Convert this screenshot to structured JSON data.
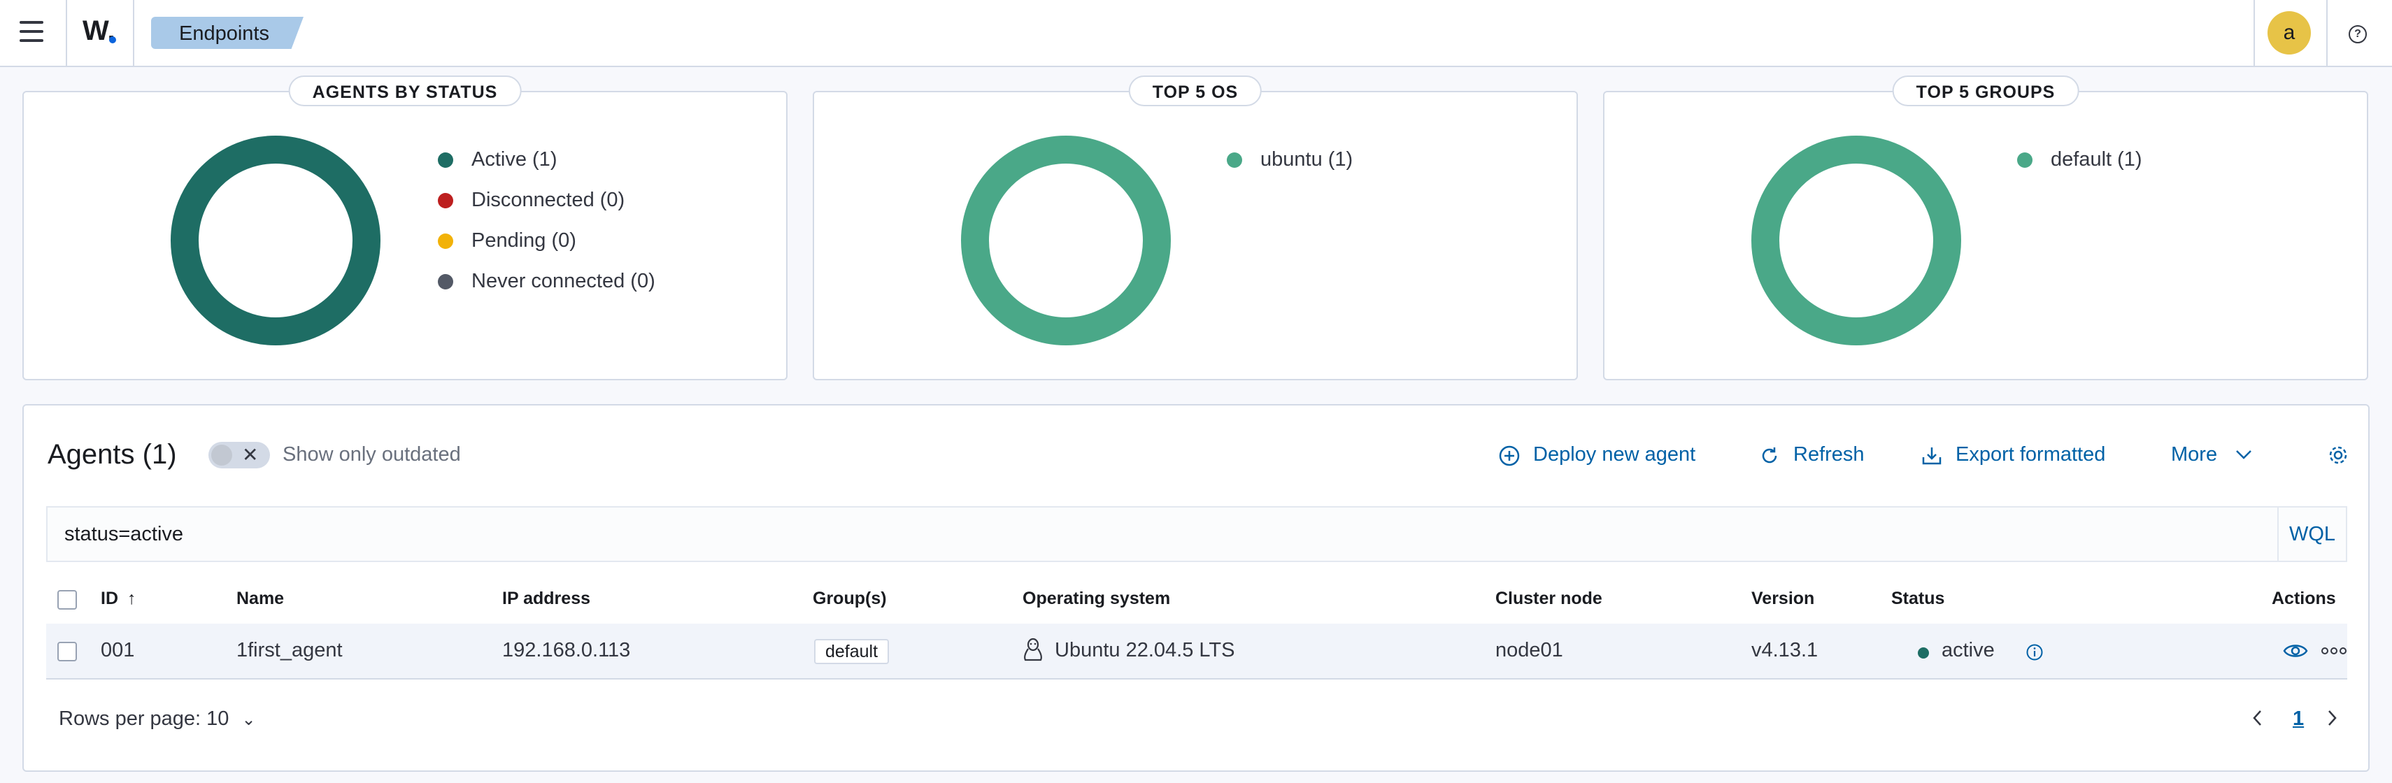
{
  "header": {
    "logo": "W.",
    "breadcrumb": "Endpoints",
    "avatar_initial": "a",
    "help_glyph": "?"
  },
  "panels": [
    {
      "title": "AGENTS BY STATUS",
      "ring_color": "#1e6d64",
      "legend": [
        {
          "label": "Active (1)",
          "color": "#1e6d64"
        },
        {
          "label": "Disconnected (0)",
          "color": "#bd1f1f"
        },
        {
          "label": "Pending (0)",
          "color": "#f2b208"
        },
        {
          "label": "Never connected (0)",
          "color": "#535966"
        }
      ]
    },
    {
      "title": "TOP 5 OS",
      "ring_color": "#4aa888",
      "legend": [
        {
          "label": "ubuntu (1)",
          "color": "#4aa888"
        }
      ]
    },
    {
      "title": "TOP 5 GROUPS",
      "ring_color": "#4aa888",
      "legend": [
        {
          "label": "default (1)",
          "color": "#4aa888"
        }
      ]
    }
  ],
  "agents": {
    "title": "Agents (1)",
    "toggle_label": "Show only outdated",
    "toggle_on": false,
    "actions": {
      "deploy": "Deploy new agent",
      "refresh": "Refresh",
      "export": "Export formatted",
      "more": "More"
    },
    "search_value": "status=active",
    "search_mode": "WQL",
    "columns": {
      "id": "ID",
      "name": "Name",
      "ip": "IP address",
      "groups": "Group(s)",
      "os": "Operating system",
      "cluster": "Cluster node",
      "version": "Version",
      "status": "Status",
      "actions": "Actions"
    },
    "sort": {
      "column": "ID",
      "direction": "ascending"
    },
    "rows": [
      {
        "id": "001",
        "name": "1first_agent",
        "ip": "192.168.0.113",
        "group": "default",
        "os": "Ubuntu 22.04.5 LTS",
        "cluster": "node01",
        "version": "v4.13.1",
        "status": "active",
        "status_color": "#1e6d64"
      }
    ],
    "rows_per_page": "Rows per page: 10",
    "current_page": "1"
  },
  "colors": {
    "link": "#0061a6",
    "active": "#1e6d64",
    "accent_green": "#4aa888"
  }
}
